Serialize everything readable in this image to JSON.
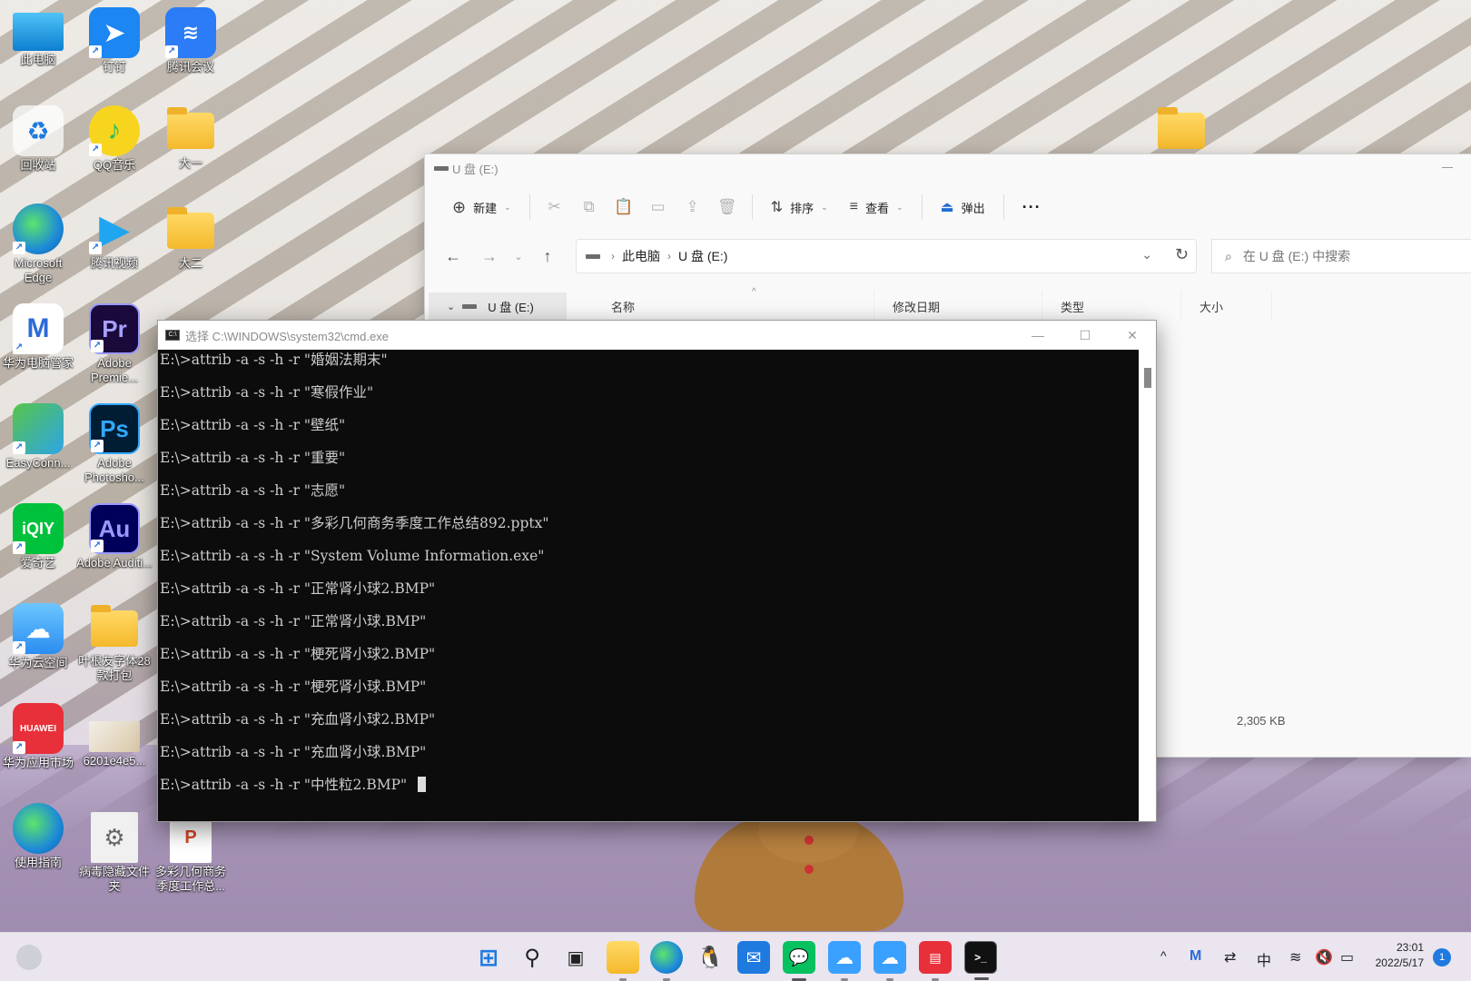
{
  "desktop": {
    "icons": [
      {
        "label": "此电脑",
        "kind": "monitor"
      },
      {
        "label": "钉钉",
        "kind": "app",
        "color": "#1c86f2"
      },
      {
        "label": "腾讯会议",
        "kind": "app",
        "color": "#2b7cf6"
      },
      {
        "label": "回收站",
        "kind": "recycle"
      },
      {
        "label": "QQ音乐",
        "kind": "app",
        "color": "#f7d51f"
      },
      {
        "label": "大一",
        "kind": "folder"
      },
      {
        "label": "Microsoft Edge",
        "kind": "app",
        "color": "#1d8bd8"
      },
      {
        "label": "腾讯视频",
        "kind": "app",
        "color": "#20a6f0"
      },
      {
        "label": "大二",
        "kind": "folder"
      },
      {
        "label": "华为电脑管家",
        "kind": "app",
        "color": "#ffffff"
      },
      {
        "label": "Adobe Premie...",
        "kind": "app",
        "color": "#1a0a3b"
      },
      {
        "label": "EasyConn...",
        "kind": "app",
        "color": "#3bb84a"
      },
      {
        "label": "Adobe Photosho...",
        "kind": "app",
        "color": "#001d34"
      },
      {
        "label": "爱奇艺",
        "kind": "app",
        "color": "#00c13b"
      },
      {
        "label": "Adobe Auditi...",
        "kind": "app",
        "color": "#00005b"
      },
      {
        "label": "华为云空间",
        "kind": "app",
        "color": "#3aa0ff"
      },
      {
        "label": "叶根友字体28款打包",
        "kind": "folder"
      },
      {
        "label": "华为应用市场",
        "kind": "app",
        "color": "#e8303a"
      },
      {
        "label": "6201e4e5...",
        "kind": "image"
      },
      {
        "label": "使用指南",
        "kind": "app",
        "color": "#1d8bd8"
      },
      {
        "label": "病毒隐藏文件夹",
        "kind": "settings"
      },
      {
        "label": "多彩几何商务季度工作总...",
        "kind": "ppt"
      }
    ]
  },
  "explorer": {
    "title": "U 盘 (E:)",
    "toolbar": {
      "new_label": "新建",
      "sort_label": "排序",
      "view_label": "查看",
      "eject_label": "弹出",
      "more_label": "···"
    },
    "breadcrumb": [
      "此电脑",
      "U 盘 (E:)"
    ],
    "search_placeholder": "在 U 盘 (E:) 中搜索",
    "nav_item": "U 盘 (E:)",
    "columns": [
      "名称",
      "修改日期",
      "类型",
      "大小"
    ],
    "size_value": "2,305 KB"
  },
  "cmd": {
    "title": "选择 C:\\WINDOWS\\system32\\cmd.exe",
    "lines": [
      "E:\\>attrib -a -s -h -r \"婚姻法期末\"",
      "E:\\>attrib -a -s -h -r \"寒假作业\"",
      "E:\\>attrib -a -s -h -r \"壁纸\"",
      "E:\\>attrib -a -s -h -r \"重要\"",
      "E:\\>attrib -a -s -h -r \"志愿\"",
      "E:\\>attrib -a -s -h -r \"多彩几何商务季度工作总结892.pptx\"",
      "E:\\>attrib -a -s -h -r \"System Volume Information.exe\"",
      "E:\\>attrib -a -s -h -r \"正常肾小球2.BMP\"",
      "E:\\>attrib -a -s -h -r \"正常肾小球.BMP\"",
      "E:\\>attrib -a -s -h -r \"梗死肾小球2.BMP\"",
      "E:\\>attrib -a -s -h -r \"梗死肾小球.BMP\"",
      "E:\\>attrib -a -s -h -r \"充血肾小球2.BMP\"",
      "E:\\>attrib -a -s -h -r \"充血肾小球.BMP\"",
      "E:\\>attrib -a -s -h -r \"中性粒2.BMP\""
    ]
  },
  "taskbar": {
    "tray_ime": "中",
    "time": "23:01",
    "date": "2022/5/17",
    "notifications": "1"
  }
}
